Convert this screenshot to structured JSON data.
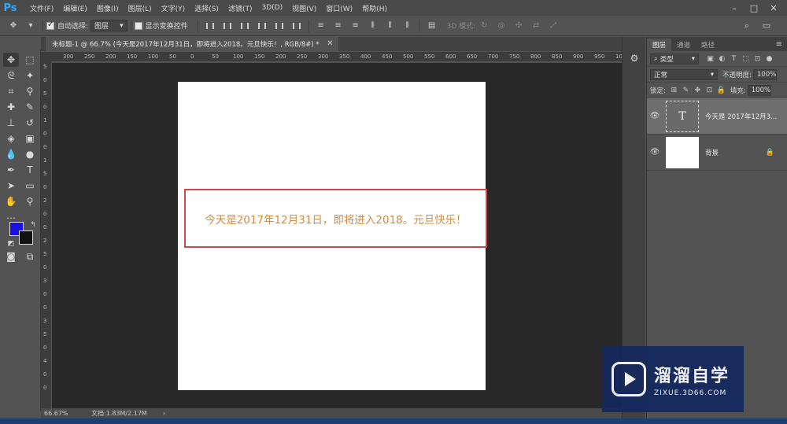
{
  "app": {
    "logo": "Ps"
  },
  "menubar": {
    "items": [
      "文件(F)",
      "编辑(E)",
      "图像(I)",
      "图层(L)",
      "文字(Y)",
      "选择(S)",
      "滤镜(T)",
      "3D(D)",
      "视图(V)",
      "窗口(W)",
      "帮助(H)"
    ],
    "window_controls": [
      "minimize-icon",
      "maximize-icon",
      "close-icon"
    ]
  },
  "options_bar": {
    "auto_select_label": "自动选择:",
    "auto_select_checked": true,
    "auto_select_target": "图层",
    "show_transform_label": "显示变换控件",
    "show_transform_checked": false,
    "mode_3d_label": "3D 模式:"
  },
  "document": {
    "tab_title": "未标题-1 @ 66.7% (今天是2017年12月31日，即将进入2018。元旦快乐！, RGB/8#) *",
    "text_content": "今天是2017年12月31日，即将进入2018。元旦快乐！",
    "text_color": "#d98a3a",
    "frame_color": "#c94a4a"
  },
  "rulers": {
    "top": [
      "300",
      "250",
      "200",
      "150",
      "100",
      "50",
      "0",
      "50",
      "100",
      "150",
      "200",
      "250",
      "300",
      "350",
      "400",
      "450",
      "500",
      "550",
      "600",
      "650",
      "700",
      "750",
      "800",
      "850",
      "900",
      "950",
      "100"
    ],
    "left": [
      "5",
      "0",
      "5",
      "0",
      "1",
      "0",
      "0",
      "1",
      "5",
      "0",
      "2",
      "0",
      "0",
      "2",
      "5",
      "0",
      "3",
      "0",
      "0",
      "3",
      "5",
      "0",
      "4",
      "0",
      "0"
    ]
  },
  "statusbar": {
    "zoom": "66.67%",
    "doc_info": "文档:1.83M/2.17M"
  },
  "colors": {
    "foreground": "#1a10e6",
    "background": "#111111"
  },
  "layers_panel": {
    "tabs": [
      "图层",
      "通道",
      "路径"
    ],
    "filter_kind": "类型",
    "blend_mode": "正常",
    "opacity_label": "不透明度:",
    "opacity_value": "100%",
    "lock_label": "锁定:",
    "fill_label": "填充:",
    "fill_value": "100%",
    "layers": [
      {
        "name": "今天是 2017年12月3...",
        "type": "text",
        "thumb_glyph": "T",
        "selected": true
      },
      {
        "name": "背景",
        "type": "background",
        "locked": true,
        "selected": false
      }
    ]
  },
  "watermark": {
    "title": "溜溜自学",
    "subtitle": "ZIXUE.3D66.COM"
  }
}
